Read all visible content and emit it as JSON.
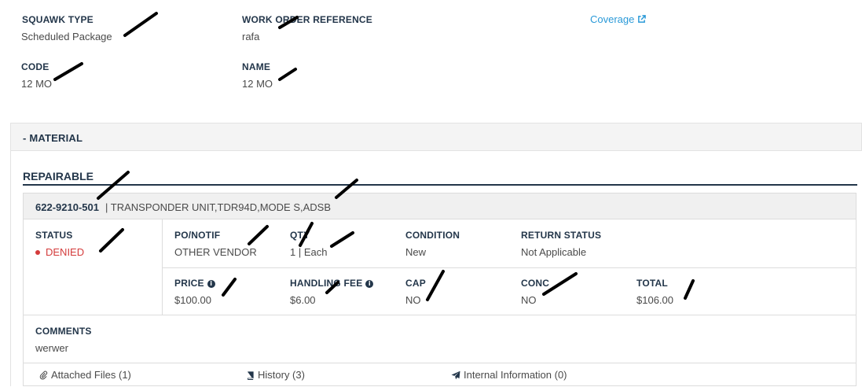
{
  "squawk": {
    "type_label": "SQUAWK TYPE",
    "type_value": "Scheduled Package",
    "wo_label": "WORK ORDER REFERENCE",
    "wo_value": "rafa",
    "code_label": "CODE",
    "code_value": "12 MO",
    "name_label": "NAME",
    "name_value": "12 MO",
    "coverage_link": "Coverage"
  },
  "material": {
    "section_label": "- MATERIAL",
    "repairable_title": "REPAIRABLE",
    "part_number": "622-9210-501",
    "part_description": "| TRANSPONDER UNIT,TDR94D,MODE S,ADSB",
    "status_label": "STATUS",
    "status_value": "DENIED",
    "po_label": "PO/NOTIF",
    "po_value": "OTHER VENDOR",
    "qty_label": "QTY",
    "qty_value": "1 | Each",
    "condition_label": "CONDITION",
    "condition_value": "New",
    "return_label": "RETURN STATUS",
    "return_value": "Not Applicable",
    "price_label": "PRICE",
    "price_value": "$100.00",
    "handling_label": "HANDLING FEE",
    "handling_value": "$6.00",
    "cap_label": "CAP",
    "cap_value": "NO",
    "conc_label": "CONC",
    "conc_value": "NO",
    "total_label": "TOTAL",
    "total_value": "$106.00",
    "comments_label": "COMMENTS",
    "comments_value": "werwer",
    "tabs": {
      "attached": "Attached Files (1)",
      "history": "History (3)",
      "internal": "Internal Information (0)"
    }
  },
  "colors": {
    "heading": "#23364a",
    "link": "#2b9ad8",
    "denied": "#d43b3b",
    "panel_bg": "#f4f4f4"
  },
  "icons": [
    "external-link-icon",
    "info-icon",
    "paperclip-icon",
    "book-icon",
    "plane-icon",
    "status-dot-icon"
  ]
}
